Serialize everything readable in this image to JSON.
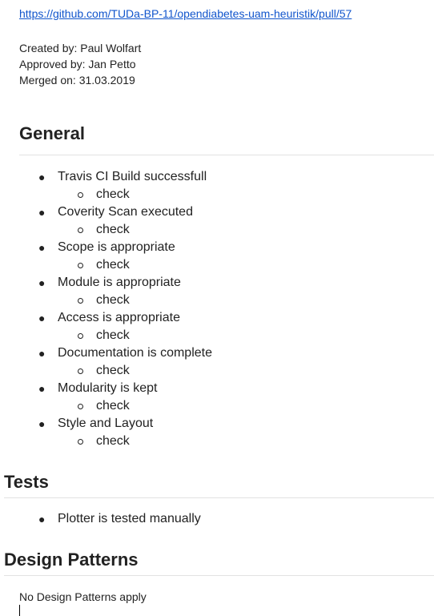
{
  "header": {
    "link": "https://github.com/TUDa-BP-11/opendiabetes-uam-heuristik/pull/57",
    "created_by": "Created by: Paul Wolfart",
    "approved_by": "Approved by: Jan Petto",
    "merged_on": "Merged on: 31.03.2019"
  },
  "general": {
    "title": "General",
    "items": [
      {
        "label": "Travis CI Build successfull",
        "sub": "check"
      },
      {
        "label": "Coverity Scan executed",
        "sub": "check"
      },
      {
        "label": "Scope is appropriate",
        "sub": "check"
      },
      {
        "label": "Module is appropriate",
        "sub": "check"
      },
      {
        "label": "Access is appropriate",
        "sub": "check"
      },
      {
        "label": "Documentation is complete",
        "sub": "check"
      },
      {
        "label": "Modularity is kept",
        "sub": "check"
      },
      {
        "label": "Style and Layout",
        "sub": "check"
      }
    ]
  },
  "tests": {
    "title": "Tests",
    "items": [
      "Plotter is tested manually"
    ]
  },
  "design_patterns": {
    "title": "Design Patterns",
    "text": "No Design Patterns apply"
  }
}
